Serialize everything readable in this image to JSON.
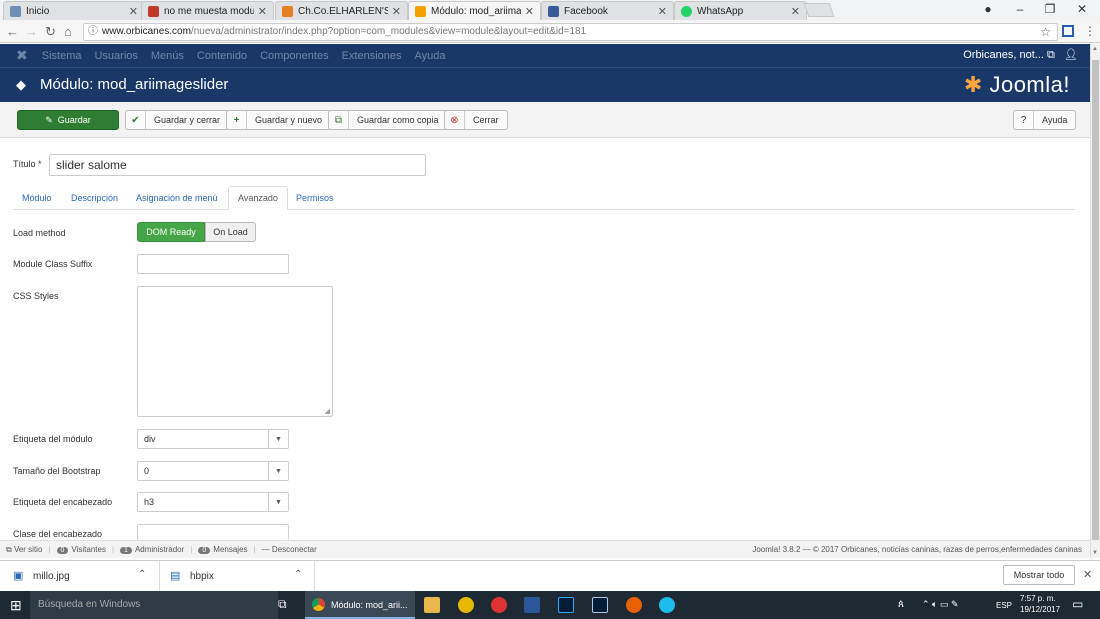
{
  "browser": {
    "tabs": [
      {
        "title": "Inicio",
        "color": "#6b8fb5"
      },
      {
        "title": "no me muesta modulos",
        "color": "#c0392b"
      },
      {
        "title": "Ch.Co.ELHARLEN'S HALI",
        "color": "#e67e22"
      },
      {
        "title": "Módulo: mod_ariimages",
        "color": "#f4a000"
      },
      {
        "title": "Facebook",
        "color": "#3b5998"
      },
      {
        "title": "WhatsApp",
        "color": "#25d366"
      }
    ],
    "url_host": "www.orbicanes.com",
    "url_path": "/nueva/administrator/index.php?option=com_modules&view=module&layout=edit&id=181"
  },
  "joomla_nav": {
    "items": [
      "Sistema",
      "Usuarios",
      "Menús",
      "Contenido",
      "Componentes",
      "Extensiones",
      "Ayuda"
    ],
    "user": "Orbicanes, not..."
  },
  "header": {
    "title": "Módulo: mod_ariimageslider",
    "logo": "Joomla!"
  },
  "toolbar": {
    "save": "Guardar",
    "save_close": "Guardar y cerrar",
    "save_new": "Guardar y nuevo",
    "save_copy": "Guardar como copia",
    "close": "Cerrar",
    "help": "Ayuda"
  },
  "form": {
    "title_label": "Título *",
    "title_value": "slider salome",
    "tabs": [
      "Módulo",
      "Descripción",
      "Asignación de menú",
      "Avanzado",
      "Permisos"
    ],
    "load_method_label": "Load method",
    "load_method_options": [
      "DOM Ready",
      "On Load"
    ],
    "suffix_label": "Module Class Suffix",
    "css_label": "CSS Styles",
    "module_tag_label": "Etiqueta del módulo",
    "module_tag_value": "div",
    "bootstrap_label": "Tamaño del Bootstrap",
    "bootstrap_value": "0",
    "header_tag_label": "Etiqueta del encabezado",
    "header_tag_value": "h3",
    "header_class_label": "Clase del encabezado"
  },
  "status": {
    "view_site": "Ver sitio",
    "visitors_count": "0",
    "visitors": "Visitantes",
    "admin_count": "1",
    "admin": "Administrador",
    "messages_count": "0",
    "messages": "Mensajes",
    "logout": "Desconectar",
    "footer": "Joomla! 3.8.2 — © 2017 Orbicanes, noticias caninas, razas de perros,enfermedades caninas"
  },
  "downloads": {
    "items": [
      "millo.jpg",
      "hbpix"
    ],
    "show_all": "Mostrar todo"
  },
  "taskbar": {
    "search": "Búsqueda en Windows",
    "active_app": "Módulo: mod_arii...",
    "lang": "ESP",
    "time": "7:57 p. m.",
    "date": "19/12/2017"
  }
}
